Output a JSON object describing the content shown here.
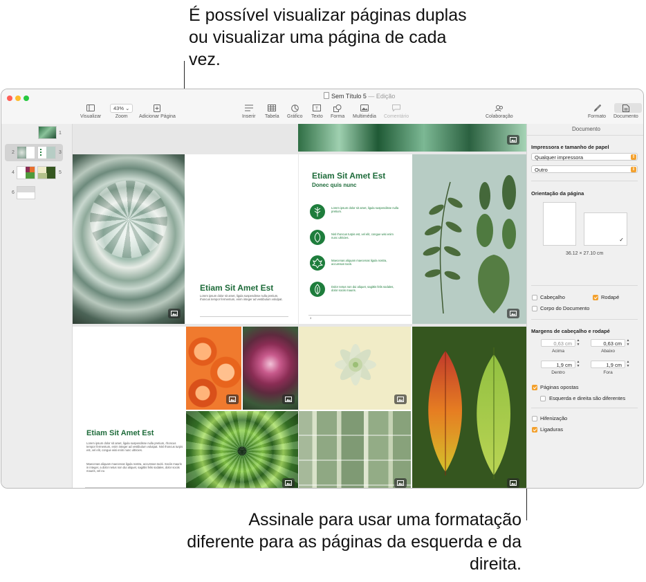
{
  "callouts": {
    "top": "É possível visualizar páginas duplas ou visualizar uma página de cada vez.",
    "bottom": "Assinale para usar uma formatação diferente para as páginas da esquerda e da direita."
  },
  "window": {
    "title": "Sem Título 5",
    "state": "— Edição"
  },
  "toolbar": {
    "view": "Visualizar",
    "zoom_value": "43%",
    "zoom": "Zoom",
    "add_page": "Adicionar Página",
    "insert": "Inserir",
    "table": "Tabela",
    "chart": "Gráfico",
    "text": "Texto",
    "shape": "Forma",
    "media": "Multimédia",
    "comment": "Comentário",
    "collaboration": "Colaboração",
    "format": "Formato",
    "document": "Documento"
  },
  "thumbnails": {
    "n1": "1",
    "n2": "2",
    "n3": "3",
    "n4": "4",
    "n5": "5",
    "n6": "6"
  },
  "pages": {
    "p2_title": "Etiam Sit Amet Est",
    "p2_body": "Lorem ipsum dolor sit amet, ligula suspendisse nulla pretium, rhoncus tempor fermentum, enim integer ad vestibulum volutpat.",
    "p3_title": "Etiam Sit Amet Est",
    "p3_subtitle": "Donec quis nunc",
    "p3_items": [
      "Lorem ipsum dolor sit amet, ligula suspendisse nulla pretium.",
      "Nisl rhoncus turpis est, vel elit, congue wisi enim nunc ultricies.",
      "Maecenas aliquam maecenas ligula nostra, accumsan taciti.",
      "Dolor netus non dui aliquet, sagittis felis sodales, dolor sociis mauris."
    ],
    "p3_footer": "3",
    "p5_title": "Etiam Sit Amet Est",
    "p5_body1": "Lorem ipsum dolor sit amet, ligula suspendisse nulla pretium, rhoncus tempor fermentum, enim integer ad vestibulum volutpat. Nisl rhoncus turpis est, vel elit, congue wisi enim nunc ultricies.",
    "p5_body2": "Maecenas aliquam maecenas ligula nostra, accumsan taciti. Sociis mauris in integer, a dolor netus non dui aliquet, sagittis felis sodales, dolor sociis mauris, vel eu"
  },
  "inspector": {
    "header": "Documento",
    "printer_section": "Impressora e tamanho de papel",
    "printer_value": "Qualquer impressora",
    "paper_value": "Outro",
    "orientation_section": "Orientação da página",
    "paper_size": "36.12 × 27.10 cm",
    "header_cb": "Cabeçalho",
    "footer_cb": "Rodapé",
    "body_cb": "Corpo do Documento",
    "margins_section": "Margens de cabeçalho e rodapé",
    "top_value": "0,63 cm",
    "top_label": "Acima",
    "bottom_value": "0,63 cm",
    "bottom_label": "Abaixo",
    "inside_value": "1,9 cm",
    "inside_label": "Dentro",
    "outside_value": "1,9 cm",
    "outside_label": "Fora",
    "facing_pages": "Páginas opostas",
    "left_right_diff": "Esquerda e direita são diferentes",
    "hyphenation": "Hifenização",
    "ligatures": "Ligaduras"
  },
  "colors": {
    "accent": "#f3a12e",
    "heading_green": "#1e6b3a",
    "close": "#ff5f57",
    "minimize": "#febc2e",
    "zoom": "#28c840"
  }
}
